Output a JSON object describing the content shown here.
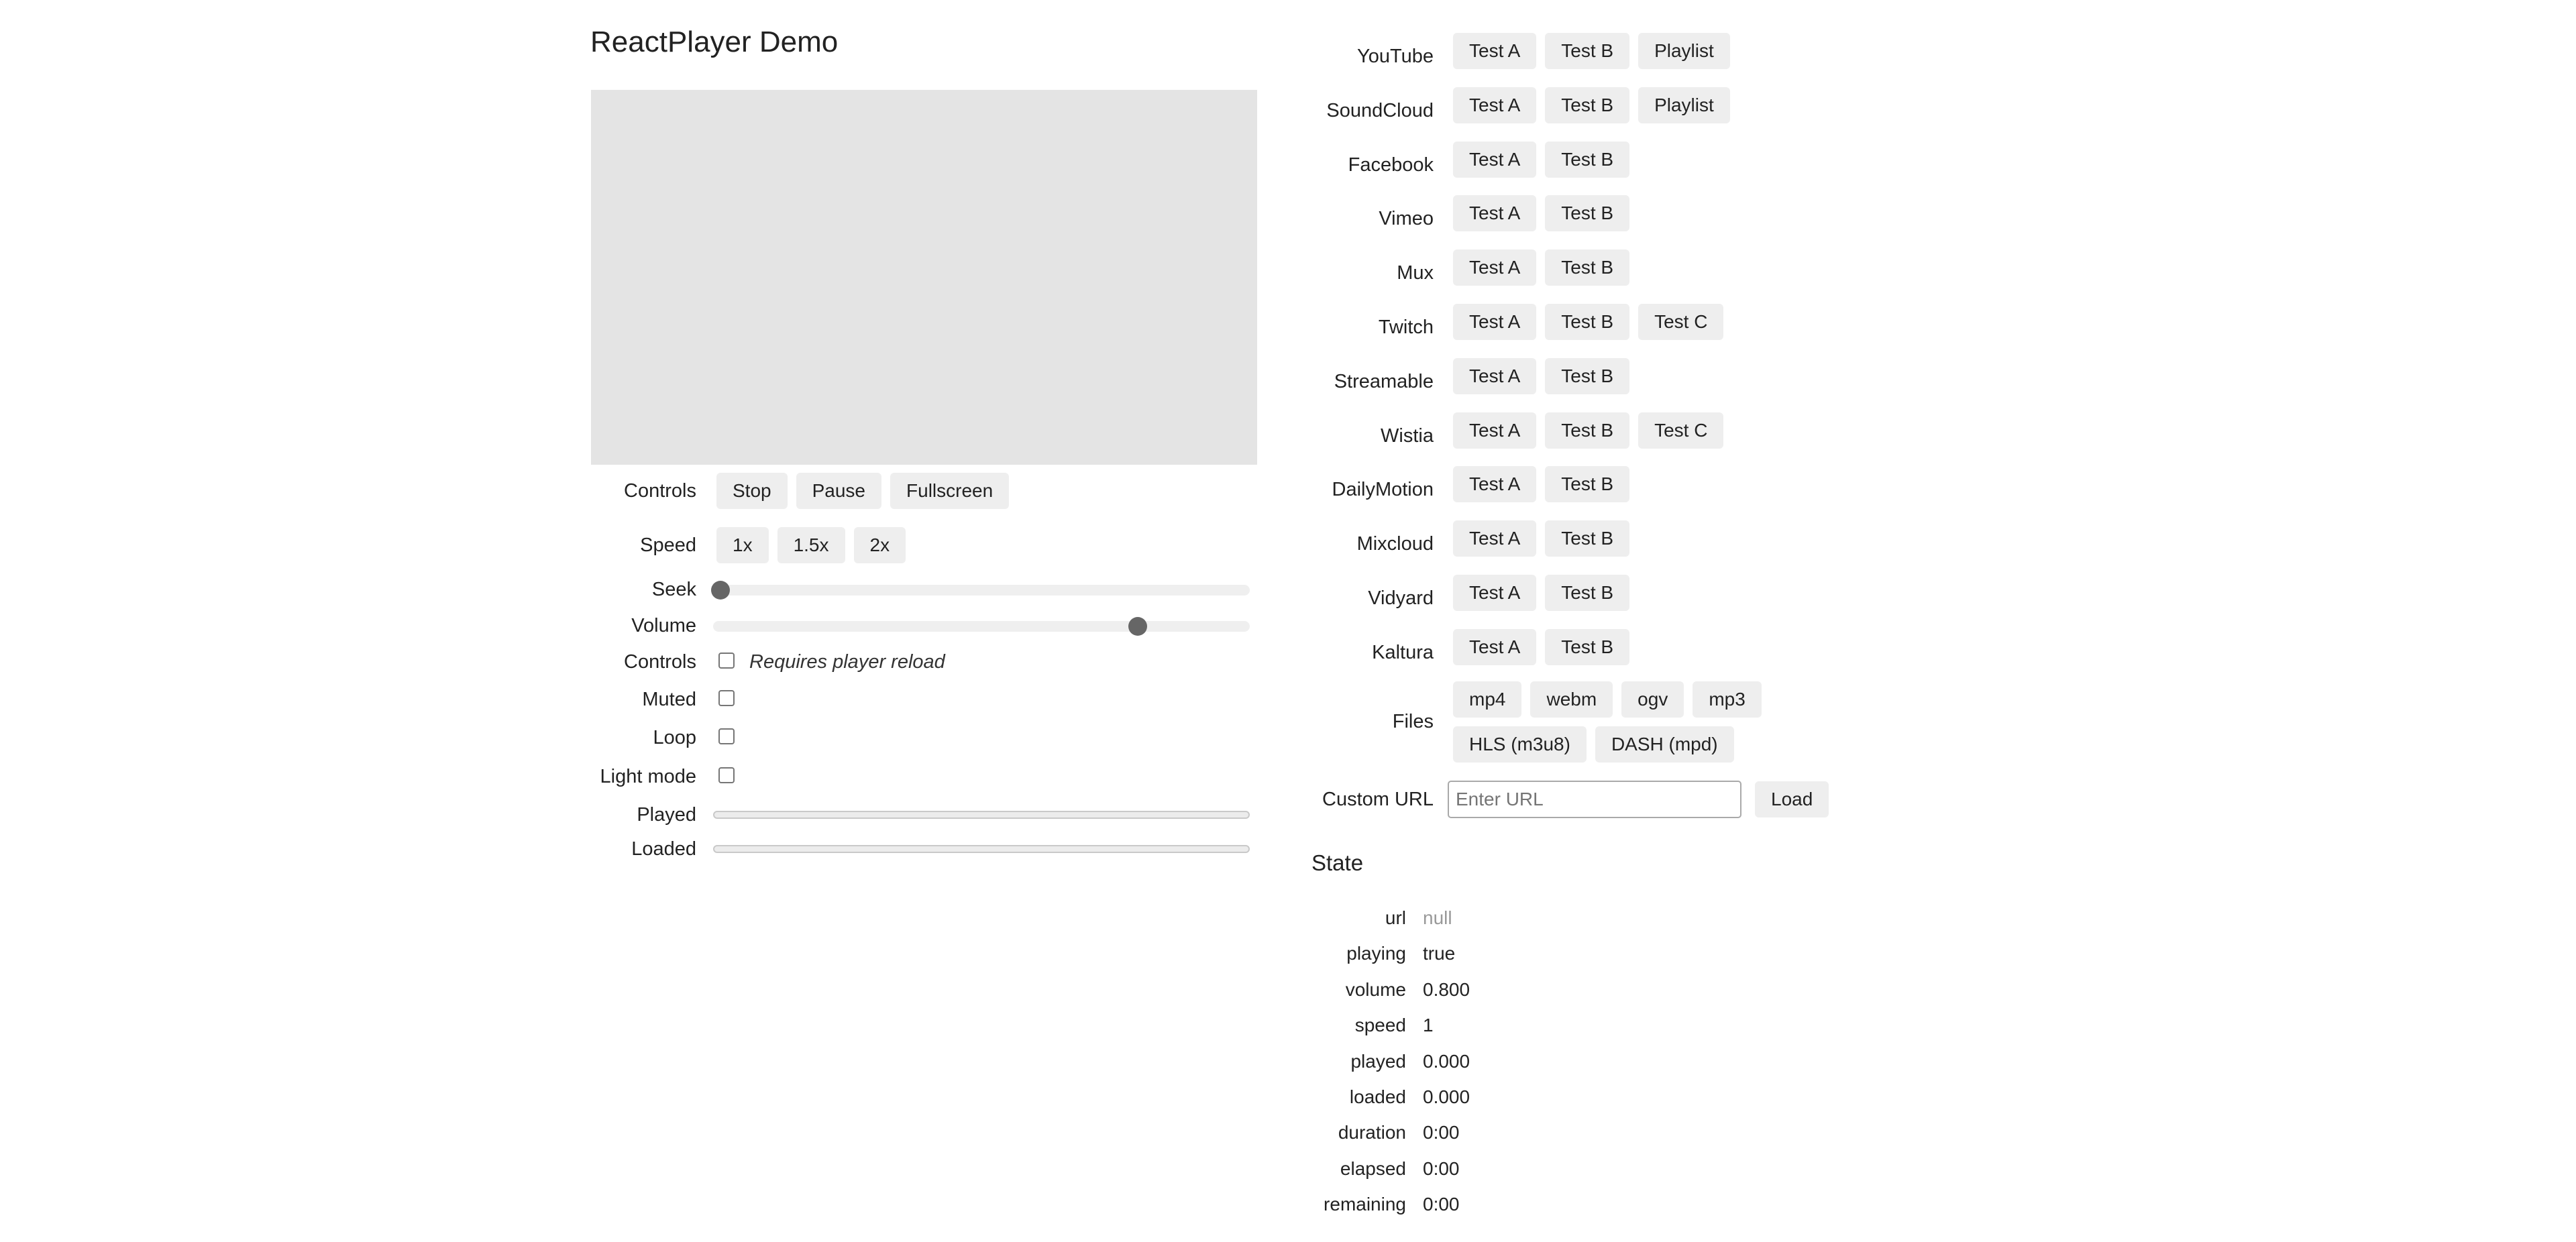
{
  "title": "ReactPlayer Demo",
  "colors": {
    "player_bg": "#e4e4e4",
    "button_bg": "#eeeeee",
    "thumb": "#666666",
    "null_text": "#999999"
  },
  "left": {
    "controls_row": {
      "label": "Controls",
      "buttons": [
        "Stop",
        "Pause",
        "Fullscreen"
      ]
    },
    "speed_row": {
      "label": "Speed",
      "buttons": [
        "1x",
        "1.5x",
        "2x"
      ]
    },
    "seek": {
      "label": "Seek",
      "value": 0.0
    },
    "volume": {
      "label": "Volume",
      "value": 0.8
    },
    "controls_checkbox": {
      "label": "Controls",
      "checked": false,
      "note": "Requires player reload"
    },
    "muted": {
      "label": "Muted",
      "checked": false
    },
    "loop": {
      "label": "Loop",
      "checked": false
    },
    "light_mode": {
      "label": "Light mode",
      "checked": false
    },
    "played": {
      "label": "Played",
      "value": 0.0
    },
    "loaded": {
      "label": "Loaded",
      "value": 0.0
    }
  },
  "providers": [
    {
      "name": "YouTube",
      "buttons": [
        "Test A",
        "Test B",
        "Playlist"
      ]
    },
    {
      "name": "SoundCloud",
      "buttons": [
        "Test A",
        "Test B",
        "Playlist"
      ]
    },
    {
      "name": "Facebook",
      "buttons": [
        "Test A",
        "Test B"
      ]
    },
    {
      "name": "Vimeo",
      "buttons": [
        "Test A",
        "Test B"
      ]
    },
    {
      "name": "Mux",
      "buttons": [
        "Test A",
        "Test B"
      ]
    },
    {
      "name": "Twitch",
      "buttons": [
        "Test A",
        "Test B",
        "Test C"
      ]
    },
    {
      "name": "Streamable",
      "buttons": [
        "Test A",
        "Test B"
      ]
    },
    {
      "name": "Wistia",
      "buttons": [
        "Test A",
        "Test B",
        "Test C"
      ]
    },
    {
      "name": "DailyMotion",
      "buttons": [
        "Test A",
        "Test B"
      ]
    },
    {
      "name": "Mixcloud",
      "buttons": [
        "Test A",
        "Test B"
      ]
    },
    {
      "name": "Vidyard",
      "buttons": [
        "Test A",
        "Test B"
      ]
    },
    {
      "name": "Kaltura",
      "buttons": [
        "Test A",
        "Test B"
      ]
    }
  ],
  "files": {
    "label": "Files",
    "row1": [
      "mp4",
      "webm",
      "ogv",
      "mp3"
    ],
    "row2": [
      "HLS (m3u8)",
      "DASH (mpd)"
    ]
  },
  "custom_url": {
    "label": "Custom URL",
    "value": "",
    "placeholder": "Enter URL",
    "load_label": "Load"
  },
  "state": {
    "heading": "State",
    "rows": [
      {
        "key": "url",
        "value": "null"
      },
      {
        "key": "playing",
        "value": "true"
      },
      {
        "key": "volume",
        "value": "0.800"
      },
      {
        "key": "speed",
        "value": "1"
      },
      {
        "key": "played",
        "value": "0.000"
      },
      {
        "key": "loaded",
        "value": "0.000"
      },
      {
        "key": "duration",
        "value": "0:00"
      },
      {
        "key": "elapsed",
        "value": "0:00"
      },
      {
        "key": "remaining",
        "value": "0:00"
      }
    ]
  }
}
